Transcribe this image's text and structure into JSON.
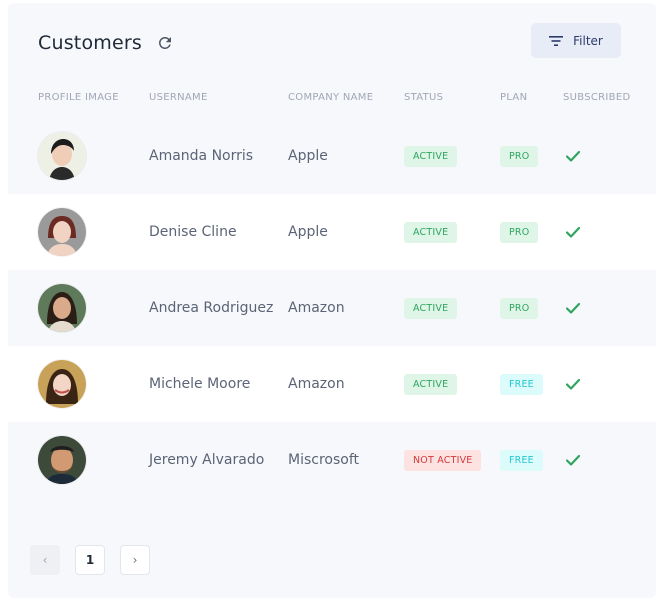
{
  "header": {
    "title": "Customers",
    "refresh_icon": "refresh-icon",
    "filter_label": "Filter",
    "filter_icon": "filter-lines-icon"
  },
  "columns": [
    "PROFILE IMAGE",
    "USERNAME",
    "COMPANY NAME",
    "STATUS",
    "PLAN",
    "SUBSCRIBED"
  ],
  "rows": [
    {
      "username": "Amanda Norris",
      "company": "Apple",
      "status": "ACTIVE",
      "plan": "PRO",
      "subscribed": true
    },
    {
      "username": "Denise Cline",
      "company": "Apple",
      "status": "ACTIVE",
      "plan": "PRO",
      "subscribed": true
    },
    {
      "username": "Andrea Rodriguez",
      "company": "Amazon",
      "status": "ACTIVE",
      "plan": "PRO",
      "subscribed": true
    },
    {
      "username": "Michele Moore",
      "company": "Amazon",
      "status": "ACTIVE",
      "plan": "FREE",
      "subscribed": true
    },
    {
      "username": "Jeremy Alvarado",
      "company": "Miscrosoft",
      "status": "NOT ACTIVE",
      "plan": "FREE",
      "subscribed": true
    }
  ],
  "pagination": {
    "prev_label": "‹",
    "current_page": "1",
    "next_label": "›"
  },
  "colors": {
    "active": "#2fa55f",
    "not_active": "#d03b3b",
    "pro": "#2fa55f",
    "free": "#22c6d3",
    "check": "#2fa55f"
  }
}
